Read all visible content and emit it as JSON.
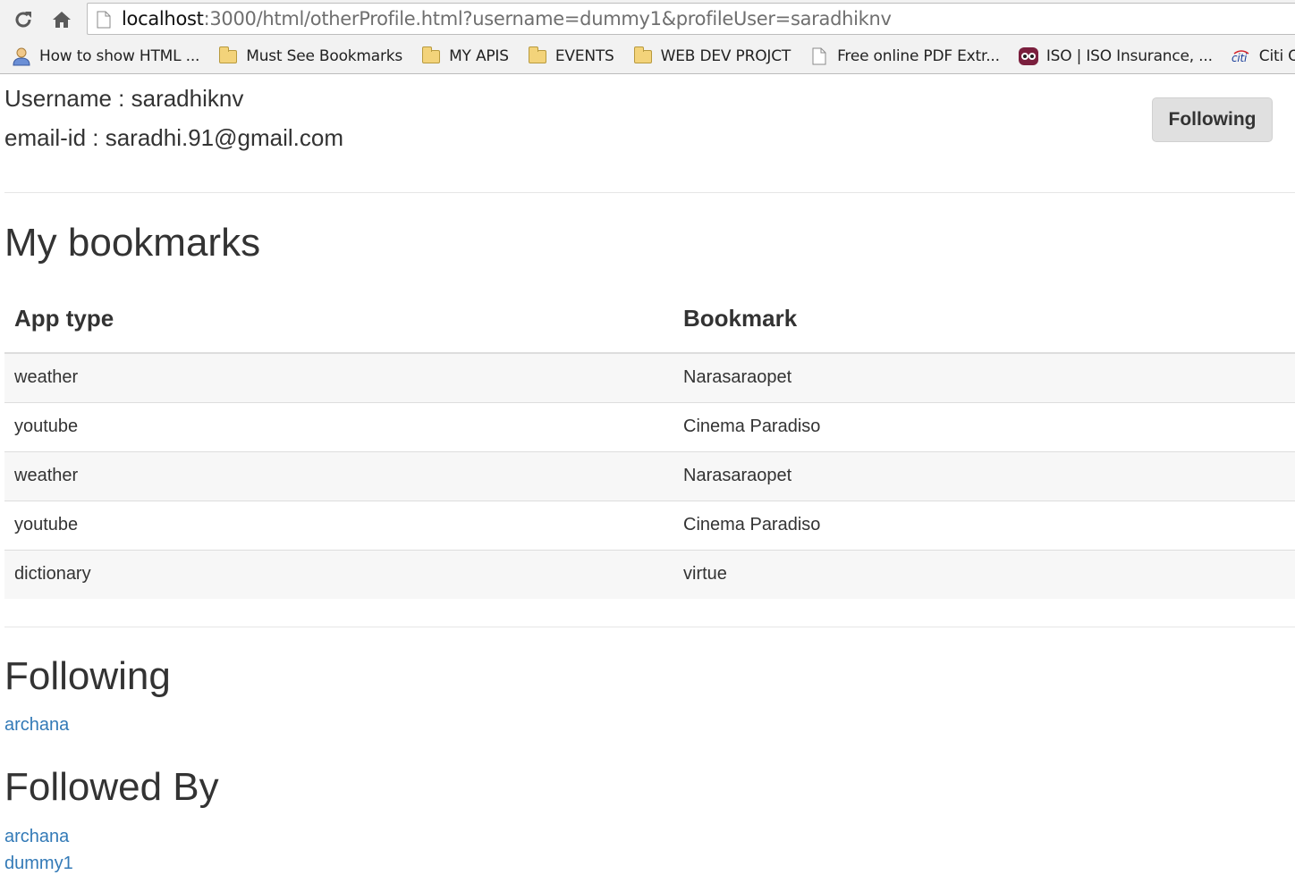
{
  "browser": {
    "url_host": "localhost",
    "url_rest": ":3000/html/otherProfile.html?username=dummy1&profileUser=saradhiknv",
    "bookmarks": [
      {
        "label": "How to show HTML ...",
        "icon": "user-icon"
      },
      {
        "label": "Must See Bookmarks",
        "icon": "folder-icon"
      },
      {
        "label": "MY APIS",
        "icon": "folder-icon"
      },
      {
        "label": "EVENTS",
        "icon": "folder-icon"
      },
      {
        "label": "WEB DEV PROJCT",
        "icon": "folder-icon"
      },
      {
        "label": "Free online PDF Extr...",
        "icon": "page-icon"
      },
      {
        "label": "ISO | ISO Insurance, ...",
        "icon": "iso-icon"
      },
      {
        "label": "Citi Online B",
        "icon": "citi-icon"
      }
    ]
  },
  "profile": {
    "username_line": "Username : saradhiknv",
    "email_line": "email-id : saradhi.91@gmail.com",
    "follow_button": "Following"
  },
  "bookmarks_section": {
    "title": "My bookmarks",
    "headers": [
      "App type",
      "Bookmark"
    ],
    "rows": [
      [
        "weather",
        "Narasaraopet"
      ],
      [
        "youtube",
        "Cinema Paradiso"
      ],
      [
        "weather",
        "Narasaraopet"
      ],
      [
        "youtube",
        "Cinema Paradiso"
      ],
      [
        "dictionary",
        "virtue"
      ]
    ]
  },
  "following_section": {
    "title": "Following",
    "users": [
      "archana"
    ]
  },
  "followed_by_section": {
    "title": "Followed By",
    "users": [
      "archana",
      "dummy1"
    ]
  },
  "colors": {
    "link": "#337ab7",
    "button_bg": "#e0e0e0",
    "stripe": "#f7f7f7"
  }
}
